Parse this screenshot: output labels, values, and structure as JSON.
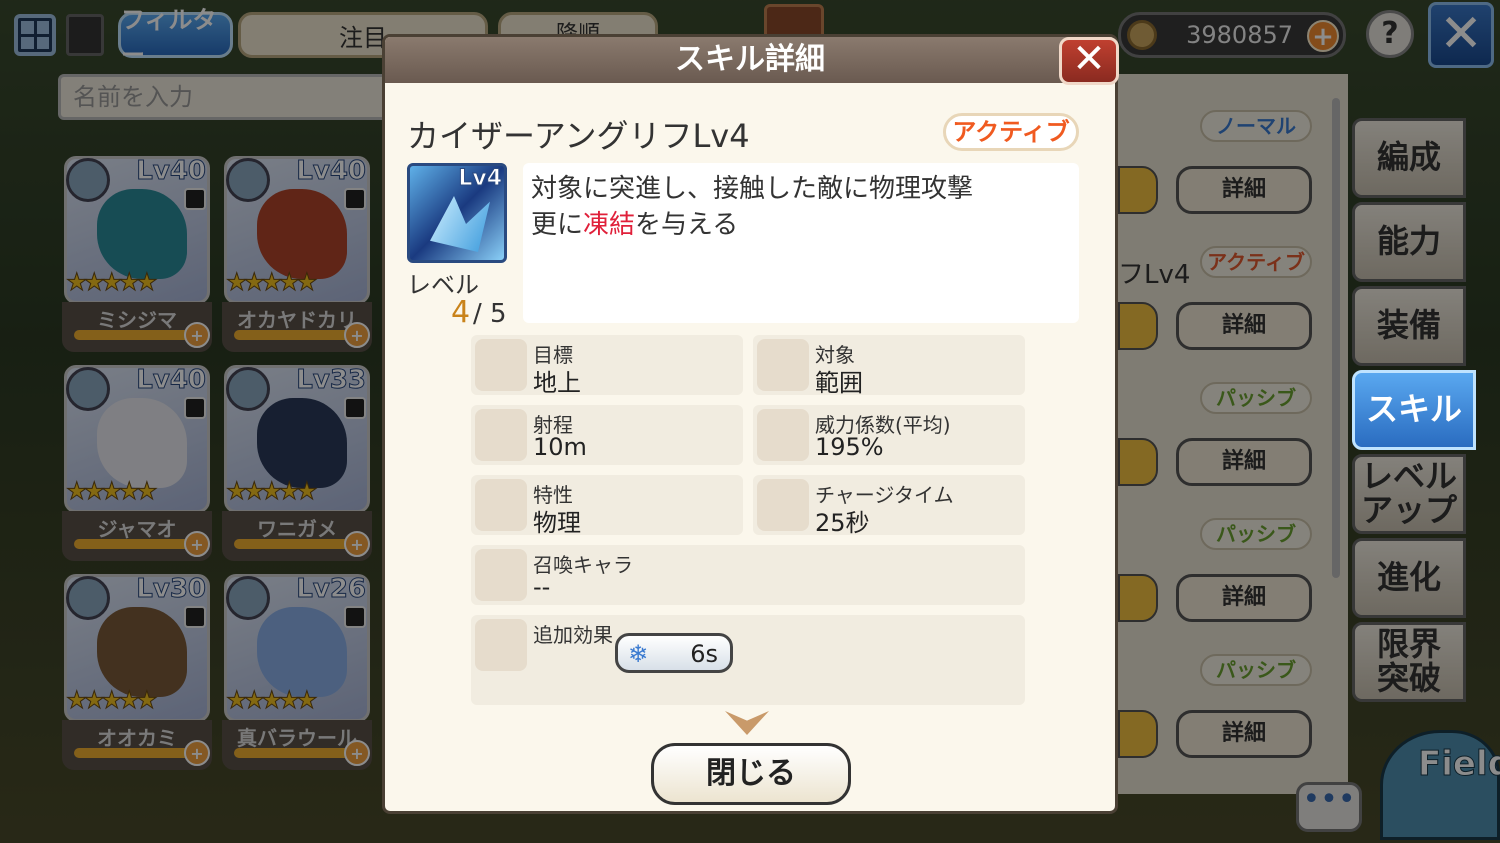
{
  "toolbar": {
    "filter_label": "フィルター",
    "sort_value": "注目",
    "order_label": "降順",
    "coins": "3980857",
    "help_label": "?",
    "close_label": "✕"
  },
  "search": {
    "placeholder": "名前を入力"
  },
  "monsters": [
    {
      "name": "ミシジマ",
      "level": "Lv40",
      "stars": "★★★★★",
      "color": "#2a8a9a"
    },
    {
      "name": "オカヤドカリ",
      "level": "Lv40",
      "stars": "★★★★★",
      "color": "#b0442a"
    },
    {
      "name": "ジャマオ",
      "level": "Lv40",
      "stars": "★★★★★",
      "color": "#e8e8ee"
    },
    {
      "name": "ワニガメ",
      "level": "Lv33",
      "stars": "★★★★★",
      "color": "#2a3a5a"
    },
    {
      "name": "オオカミ",
      "level": "Lv30",
      "stars": "★★★★★",
      "color": "#7a5a3a"
    },
    {
      "name": "真バラウール",
      "level": "Lv26",
      "stars": "★★★★★",
      "color": "#8ab0e8"
    }
  ],
  "background_list": {
    "rows": [
      {
        "tag": "ノーマル",
        "tag_color": "#3a7ad0",
        "skill_name": "",
        "detail_label": "詳細"
      },
      {
        "tag": "アクティブ",
        "tag_color": "#e05a30",
        "skill_name": "フLv4",
        "detail_label": "詳細"
      },
      {
        "tag": "パッシブ",
        "tag_color": "#6aa030",
        "skill_name": "",
        "detail_label": "詳細"
      },
      {
        "tag": "パッシブ",
        "tag_color": "#6aa030",
        "skill_name": "",
        "detail_label": "詳細"
      },
      {
        "tag": "パッシブ",
        "tag_color": "#6aa030",
        "skill_name": "",
        "detail_label": "詳細"
      }
    ]
  },
  "side_tabs": [
    {
      "label": "編成",
      "active": false
    },
    {
      "label": "能力",
      "active": false
    },
    {
      "label": "装備",
      "active": false
    },
    {
      "label": "スキル",
      "active": true
    },
    {
      "label": "レベル\nアップ",
      "active": false
    },
    {
      "label": "進化",
      "active": false
    },
    {
      "label": "限界\n突破",
      "active": false
    }
  ],
  "field_label": "Field",
  "chat_label": "•••",
  "modal": {
    "title": "スキル詳細",
    "close_icon": "✕",
    "skill_name": "カイザーアングリフLv4",
    "type_tag": "アクティブ",
    "icon_level": "Lv4",
    "level_label": "レベル",
    "level_current": "4",
    "level_sep_max": "/ 5",
    "description": {
      "line1": "対象に突進し、接触した敵に物理攻撃",
      "line2_prefix": "更に",
      "line2_highlight": "凍結",
      "line2_suffix": "を与える"
    },
    "stats": {
      "target": {
        "label": "目標",
        "value": "地上"
      },
      "scope": {
        "label": "対象",
        "value": "範囲"
      },
      "range": {
        "label": "射程",
        "value": "10m"
      },
      "power": {
        "label": "威力係数(平均)",
        "value": "195%"
      },
      "trait": {
        "label": "特性",
        "value": "物理"
      },
      "charge": {
        "label": "チャージタイム",
        "value": "25秒"
      },
      "summon": {
        "label": "召喚キャラ",
        "value": "--"
      },
      "effect": {
        "label": "追加効果",
        "icon": "❄",
        "duration": "6s"
      }
    },
    "close_button": "閉じる"
  },
  "colors": {
    "highlight": "#e0203a",
    "level_current": "#c9831a",
    "active_tag": "#f05a20",
    "tab_active": "#2a6cc0"
  }
}
